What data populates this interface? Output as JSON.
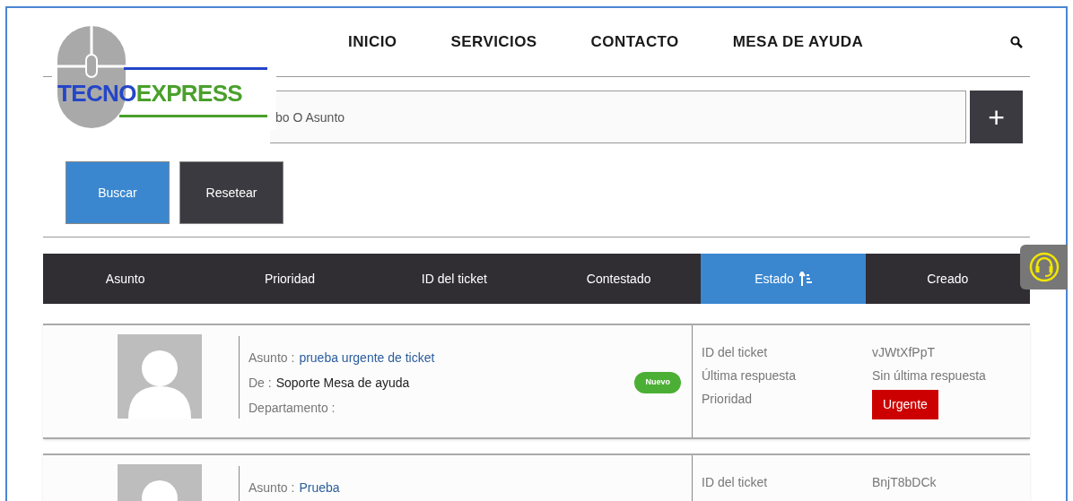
{
  "logo": {
    "part_1": "TECNO",
    "part_2": "EXPRESS"
  },
  "nav": [
    {
      "label": "INICIO"
    },
    {
      "label": "SERVICIOS"
    },
    {
      "label": "CONTACTO"
    },
    {
      "label": "MESA DE AYUDA"
    }
  ],
  "search": {
    "placeholder": "bo O Asunto",
    "add_button": "+"
  },
  "buttons": [
    {
      "label": "Buscar",
      "kind": "primary"
    },
    {
      "label": "Resetear",
      "kind": "secondary"
    }
  ],
  "columns": [
    {
      "label": "Asunto",
      "selected": false
    },
    {
      "label": "Prioridad",
      "selected": false
    },
    {
      "label": "ID del ticket",
      "selected": false
    },
    {
      "label": "Contestado",
      "selected": false
    },
    {
      "label": "Estado",
      "selected": true
    },
    {
      "label": "Creado",
      "selected": false
    }
  ],
  "tickets": [
    {
      "subject_label": "Asunto :",
      "subject": "prueba urgente de ticket",
      "from_label": "De :",
      "from": "Soporte Mesa de ayuda",
      "department_label": "Departamento :",
      "status": "Nuevo",
      "id_label": "ID del ticket",
      "id": "vJWtXfPpT",
      "reply_label": "Última respuesta",
      "reply": "Sin última respuesta",
      "priority_label": "Prioridad",
      "priority": "Urgente"
    },
    {
      "subject_label": "Asunto :",
      "subject": "Prueba",
      "id_label": "ID del ticket",
      "id": "BnjT8bDCk"
    }
  ]
}
